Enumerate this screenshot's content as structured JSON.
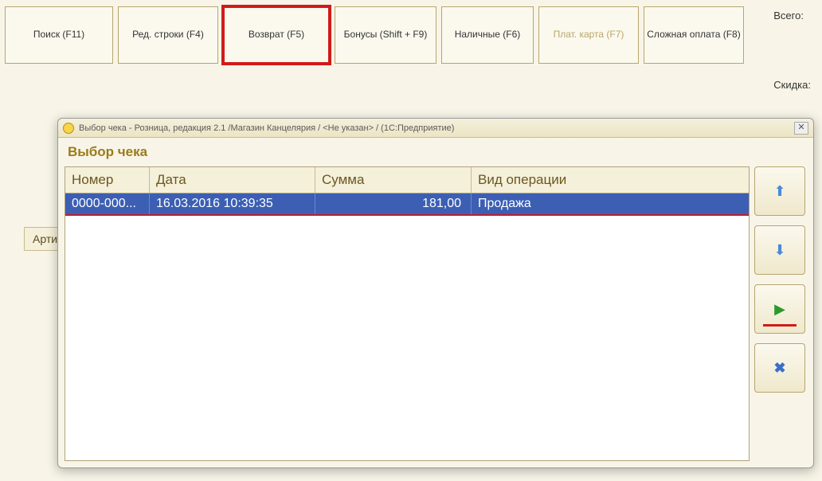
{
  "toolbar": {
    "buttons": [
      {
        "label": "Поиск (F11)"
      },
      {
        "label": "Ред. строки (F4)"
      },
      {
        "label": "Возврат (F5)"
      },
      {
        "label": "Бонусы (Shift + F9)"
      },
      {
        "label": "Наличные (F6)"
      },
      {
        "label": "Плат. карта (F7)"
      },
      {
        "label": "Сложная оплата (F8)"
      }
    ]
  },
  "labels": {
    "total": "Всего:",
    "discount": "Скидка:"
  },
  "background": {
    "column_label": "Арти"
  },
  "modal": {
    "titlebar": "Выбор чека - Розница, редакция 2.1 /Магазин Канцелярия / <Не указан> / (1С:Предприятие)",
    "heading": "Выбор чека",
    "columns": {
      "number": "Номер",
      "date": "Дата",
      "sum": "Сумма",
      "op": "Вид операции"
    },
    "rows": [
      {
        "number": "0000-000...",
        "date": "16.03.2016 10:39:35",
        "sum": "181,00",
        "op": "Продажа"
      }
    ],
    "side": {
      "up": "⬆",
      "down": "⬇",
      "play": "▶",
      "close": "✖"
    }
  }
}
